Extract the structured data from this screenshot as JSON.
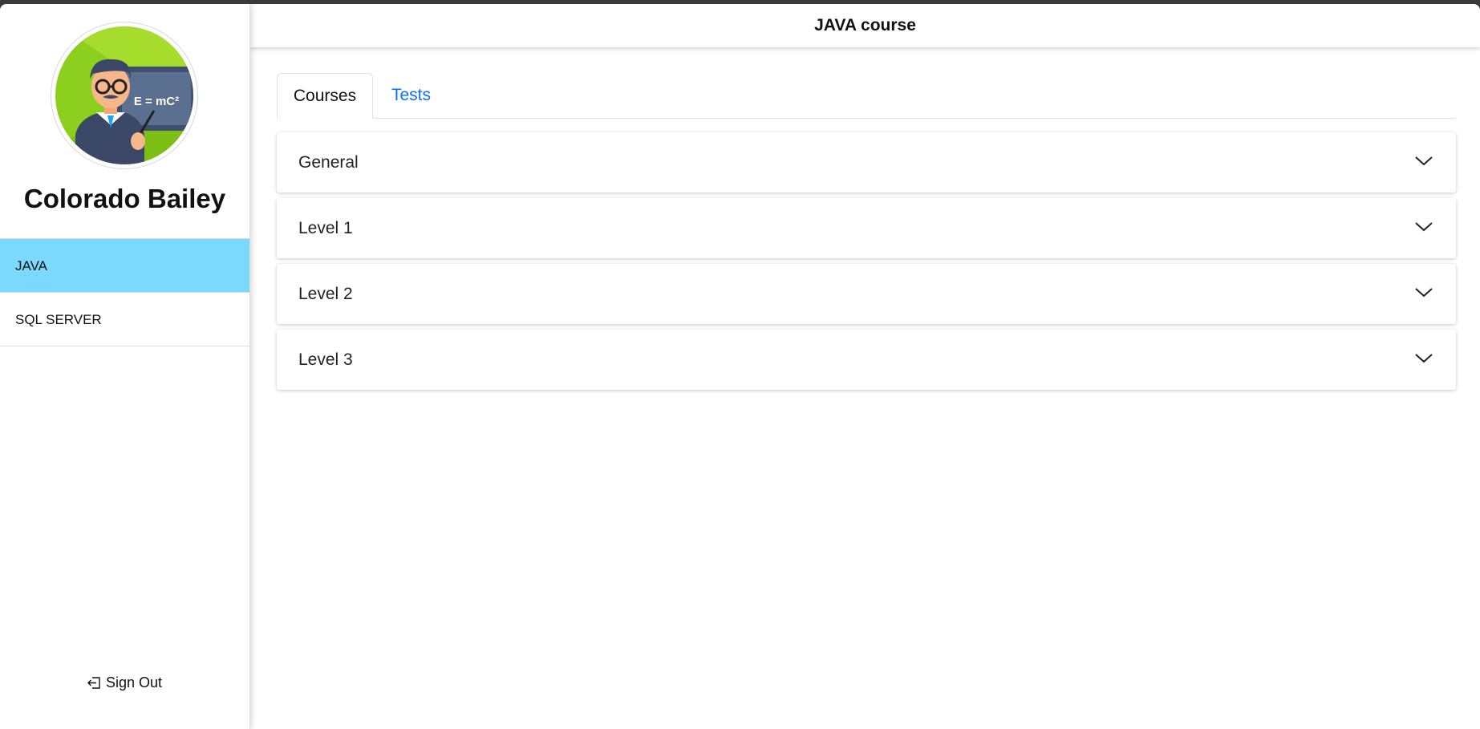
{
  "user": {
    "name": "Colorado Bailey",
    "avatar_text": "E = mC²"
  },
  "sidebar": {
    "items": [
      {
        "label": "JAVA",
        "active": true
      },
      {
        "label": "SQL SERVER",
        "active": false
      }
    ],
    "signout_label": "Sign Out"
  },
  "header": {
    "title": "JAVA course"
  },
  "tabs": [
    {
      "label": "Courses",
      "active": true
    },
    {
      "label": "Tests",
      "active": false
    }
  ],
  "accordion": [
    {
      "label": "General"
    },
    {
      "label": "Level 1"
    },
    {
      "label": "Level 2"
    },
    {
      "label": "Level 3"
    }
  ],
  "colors": {
    "active_nav": "#7bd9fe",
    "tab_link": "#0d6efd"
  }
}
